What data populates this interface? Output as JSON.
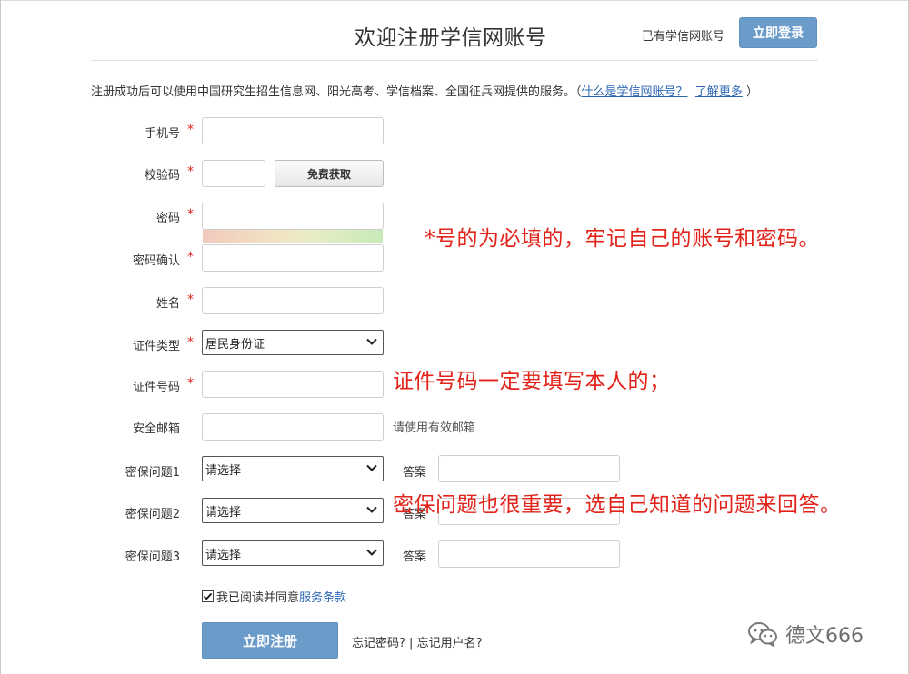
{
  "header": {
    "title": "欢迎注册学信网账号",
    "have_account": "已有学信网账号",
    "login_button": "立即登录"
  },
  "intro": {
    "text": "注册成功后可以使用中国研究生招生信息网、阳光高考、学信档案、全国征兵网提供的服务。（",
    "link_what": "什么是学信网账号？",
    "link_more": "了解更多",
    "close_paren": "）"
  },
  "form": {
    "phone_label": "手机号",
    "code_label": "校验码",
    "code_button": "免费获取",
    "password_label": "密码",
    "password_confirm_label": "密码确认",
    "name_label": "姓名",
    "id_type_label": "证件类型",
    "id_type_value": "居民身份证",
    "id_number_label": "证件号码",
    "email_label": "安全邮箱",
    "email_hint": "请使用有效邮箱",
    "q1_label": "密保问题1",
    "q2_label": "密保问题2",
    "q3_label": "密保问题3",
    "q_placeholder": "请选择",
    "answer_label": "答案",
    "required_mark": "*"
  },
  "agree": {
    "text": "我已阅读并同意",
    "link": "服务条款",
    "checked": true
  },
  "actions": {
    "register_button": "立即注册",
    "forgot_password": "忘记密码?",
    "separator": " | ",
    "forgot_username": "忘记用户名?"
  },
  "annotations": {
    "required_note": "*号的为必填的，牢记自己的账号和密码。",
    "id_note": "证件号码一定要填写本人的；",
    "security_note": "密保问题也很重要，选自己知道的问题来回答。"
  },
  "watermark": {
    "text": "德文666",
    "icon": "wechat-icon"
  },
  "colors": {
    "primary_button": "#6b9cc9",
    "link": "#2d67b4",
    "required": "#e2231a",
    "annotation": "#e2231a"
  }
}
